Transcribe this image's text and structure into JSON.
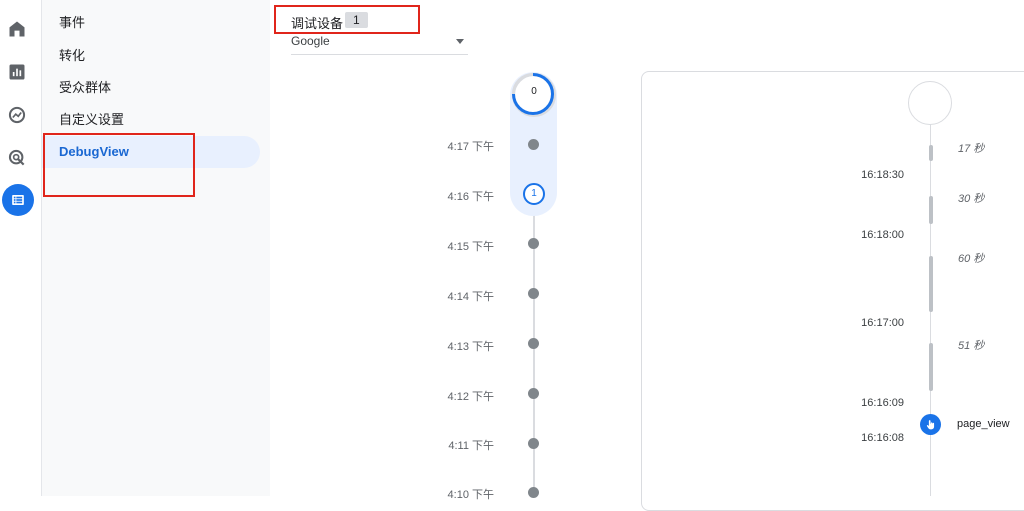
{
  "subnav": {
    "items": [
      {
        "label": "事件"
      },
      {
        "label": "转化"
      },
      {
        "label": "受众群体"
      },
      {
        "label": "自定义设置"
      },
      {
        "label": "DebugView"
      }
    ]
  },
  "device": {
    "label": "调试设备",
    "count": "1",
    "selected": "Google"
  },
  "minutes_stream": {
    "top_count": "0",
    "badge_count": "1",
    "times": [
      "4:17 下午",
      "4:16 下午",
      "4:15 下午",
      "4:14 下午",
      "4:13 下午",
      "4:12 下午",
      "4:11 下午",
      "4:10 下午"
    ]
  },
  "seconds_stream": {
    "times": [
      "16:18:30",
      "16:18:00",
      "16:17:00",
      "16:16:09",
      "16:16:08"
    ],
    "durations": [
      "17 秒",
      "30 秒",
      "60 秒",
      "51 秒"
    ],
    "event": {
      "name": "page_view",
      "icon": "touch-icon"
    }
  },
  "colors": {
    "accent": "#1a73e8",
    "annotation": "#e0251b"
  }
}
